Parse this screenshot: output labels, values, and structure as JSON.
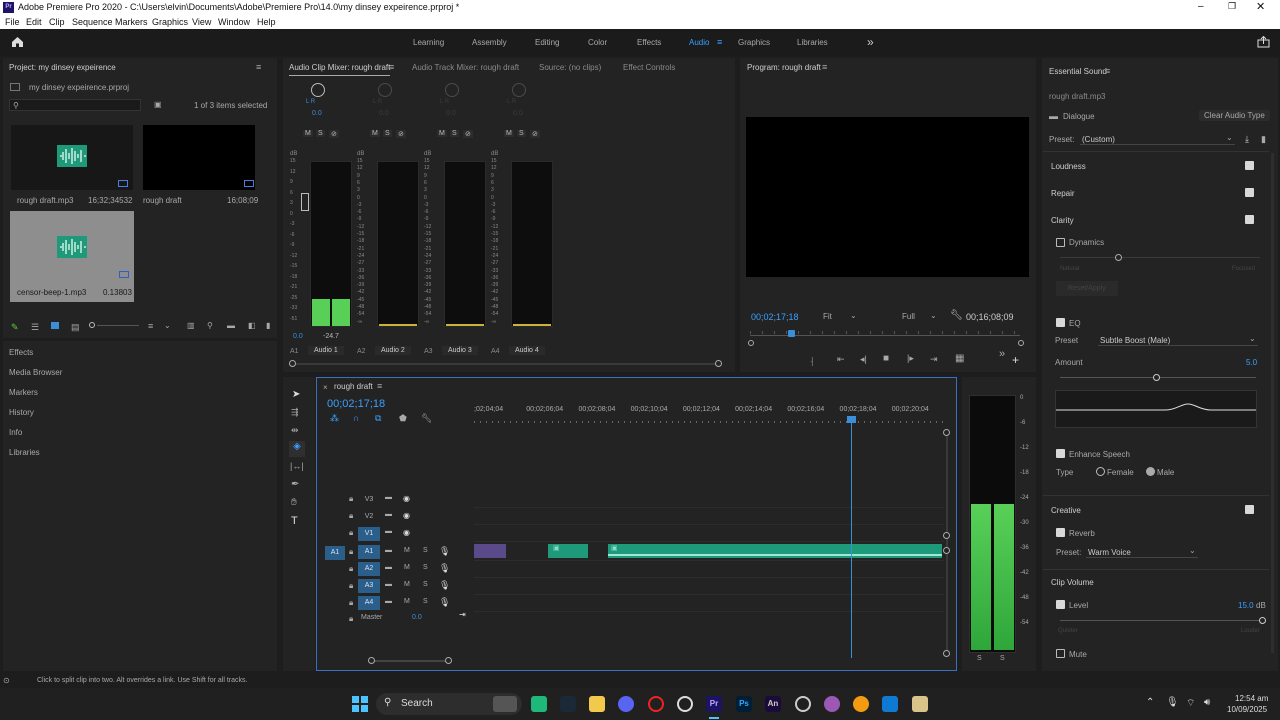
{
  "window": {
    "title": "Adobe Premiere Pro 2020 - C:\\Users\\elvin\\Documents\\Adobe\\Premiere Pro\\14.0\\my dinsey expeirence.prproj *",
    "app_badge": "Pr"
  },
  "menu": [
    "File",
    "Edit",
    "Clip",
    "Sequence",
    "Markers",
    "Graphics",
    "View",
    "Window",
    "Help"
  ],
  "workspaces": [
    "Learning",
    "Assembly",
    "Editing",
    "Color",
    "Effects",
    "Audio",
    "Graphics",
    "Libraries"
  ],
  "active_workspace": "Audio",
  "project": {
    "title": "Project: my dinsey expeirence",
    "file": "my dinsey expeirence.prproj",
    "items_count": "1 of 3 items selected",
    "items": [
      {
        "name": "rough draft.mp3",
        "duration": "16;32;34532"
      },
      {
        "name": "rough draft",
        "duration": "16;08;09"
      },
      {
        "name": "censor-beep-1.mp3",
        "duration": "0.13803"
      }
    ]
  },
  "left_nav": [
    "Effects",
    "Media Browser",
    "Markers",
    "History",
    "Info",
    "Libraries"
  ],
  "mixer": {
    "tabs": [
      "Audio Clip Mixer: rough draft",
      "Audio Track Mixer: rough draft",
      "Source: (no clips)",
      "Effect Controls"
    ],
    "lr": "L  R",
    "knob_value": "0.0",
    "msm": [
      "M",
      "S",
      "⊘"
    ],
    "db_label": "dB",
    "scale": [
      "15",
      "12",
      "9",
      "6",
      "3",
      "0",
      "-3",
      "-6",
      "-9",
      "-12",
      "-15",
      "-18",
      "-21",
      "-24",
      "-27",
      "-33",
      "-36",
      "-39",
      "-42",
      "-45",
      "-48",
      "-54",
      "-∞"
    ],
    "left_scale": [
      "15",
      "12",
      "9",
      "6",
      "3",
      "0",
      "-3",
      "-6",
      "-9",
      "-12",
      "-15",
      "-18",
      "-21",
      "-25",
      "-33",
      "-51"
    ],
    "channels": [
      {
        "id": "A1",
        "name": "Audio 1",
        "value": "0.0",
        "peak": "-24.7",
        "level": 0.16
      },
      {
        "id": "A2",
        "name": "Audio 2"
      },
      {
        "id": "A3",
        "name": "Audio 3"
      },
      {
        "id": "A4",
        "name": "Audio 4"
      }
    ]
  },
  "program": {
    "title": "Program: rough draft",
    "timecode": "00;02;17;18",
    "fit": "Fit",
    "quality": "Full",
    "duration": "00;16;08;09",
    "playhead_fraction": 0.14
  },
  "timeline": {
    "tab": "rough draft",
    "timecode": "00;02;17;18",
    "ruler": [
      ";02;04;04",
      "00;02;06;04",
      "00;02;08;04",
      "00;02;10;04",
      "00;02;12;04",
      "00;02;14;04",
      "00;02;16;04",
      "00;02;18;04",
      "00;02;20;04"
    ],
    "video_tracks": [
      "V3",
      "V2",
      "V1"
    ],
    "audio_tracks": [
      "A1",
      "A2",
      "A3",
      "A4"
    ],
    "source_patch": "A1",
    "master_label": "Master",
    "master_value": "0.0",
    "m": "M",
    "s": "S"
  },
  "meter_scale": [
    "0",
    "-6",
    "-12",
    "-18",
    "-24",
    "-30",
    "-36",
    "-42",
    "-48",
    "-54"
  ],
  "meter_solo": [
    "S",
    "S"
  ],
  "essential": {
    "title": "Essential Sound",
    "clip": "rough draft.mp3",
    "type": "Dialogue",
    "clear": "Clear Audio Type",
    "preset_label": "Preset:",
    "preset_value": "(Custom)",
    "sections": [
      "Loudness",
      "Repair",
      "Clarity"
    ],
    "dynamics": "Dynamics",
    "dyn_left": "Natural",
    "dyn_right": "Focused",
    "reset": "Reset/Apply",
    "eq": "EQ",
    "eq_preset_label": "Preset",
    "eq_preset": "Subtle Boost (Male)",
    "amount": "Amount",
    "amount_value": "5.0",
    "enhance": "Enhance Speech",
    "type_label": "Type",
    "female": "Female",
    "male": "Male",
    "creative": "Creative",
    "reverb": "Reverb",
    "reverb_preset_label": "Preset:",
    "reverb_preset": "Warm Voice",
    "clip_volume": "Clip Volume",
    "level": "Level",
    "level_value": "15.0",
    "level_unit": "dB",
    "quieter": "Quieter",
    "louder": "Louder",
    "mute": "Mute"
  },
  "status": "Click to split clip into two. Alt overrides a link. Use Shift for all tracks.",
  "taskbar": {
    "search": "Search",
    "time": "12:54 am",
    "date": "10/09/2025"
  }
}
